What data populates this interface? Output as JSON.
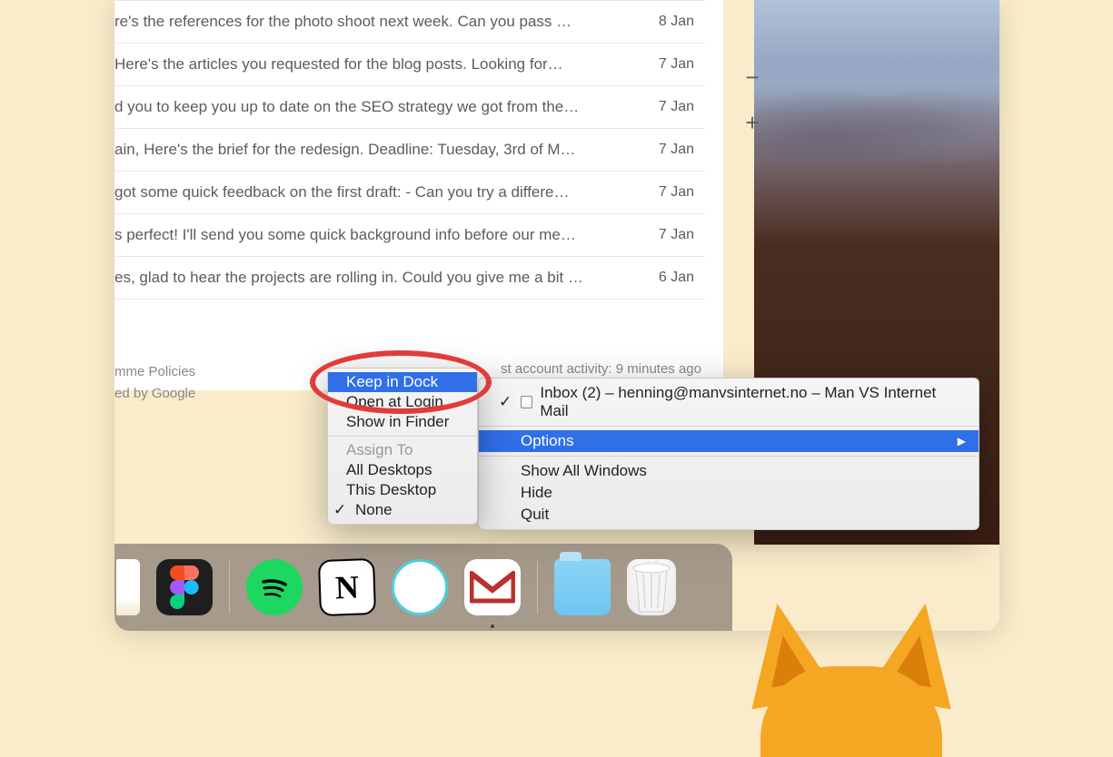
{
  "mail": {
    "rows": [
      {
        "subject": "re's the references for the photo shoot next week. Can you pass …",
        "date": "8 Jan"
      },
      {
        "subject": "Here's the articles you requested for the blog posts. Looking for…",
        "date": "7 Jan"
      },
      {
        "subject": "d you to keep you up to date on the SEO strategy we got from the…",
        "date": "7 Jan"
      },
      {
        "subject": "ain, Here's the brief for the redesign. Deadline: Tuesday, 3rd of M…",
        "date": "7 Jan"
      },
      {
        "subject": "got some quick feedback on the first draft: - Can you try a differe…",
        "date": "7 Jan"
      },
      {
        "subject": "s perfect! I'll send you some quick background info before our me…",
        "date": "7 Jan"
      },
      {
        "subject": "es, glad to hear the projects are rolling in. Could you give me a bit …",
        "date": "6 Jan"
      }
    ],
    "footer_line1": "mme Policies",
    "footer_line2": "ed by Google",
    "activity": "st account activity: 9 minutes ago"
  },
  "sidebar": {
    "minus": "−",
    "plus": "+"
  },
  "context_menu": {
    "window_title": "Inbox (2) – henning@manvsinternet.no – Man VS Internet Mail",
    "options": "Options",
    "show_all": "Show All Windows",
    "hide": "Hide",
    "quit": "Quit"
  },
  "submenu": {
    "keep_in_dock": "Keep in Dock",
    "open_at_login": "Open at Login",
    "show_in_finder": "Show in Finder",
    "assign_to": "Assign To",
    "all_desktops": "All Desktops",
    "this_desktop": "This Desktop",
    "none": "None"
  },
  "dock": {
    "apps": [
      "notes",
      "figma",
      "sep",
      "spotify",
      "notion",
      "webapp",
      "gmail",
      "sep",
      "folder",
      "trash"
    ]
  }
}
